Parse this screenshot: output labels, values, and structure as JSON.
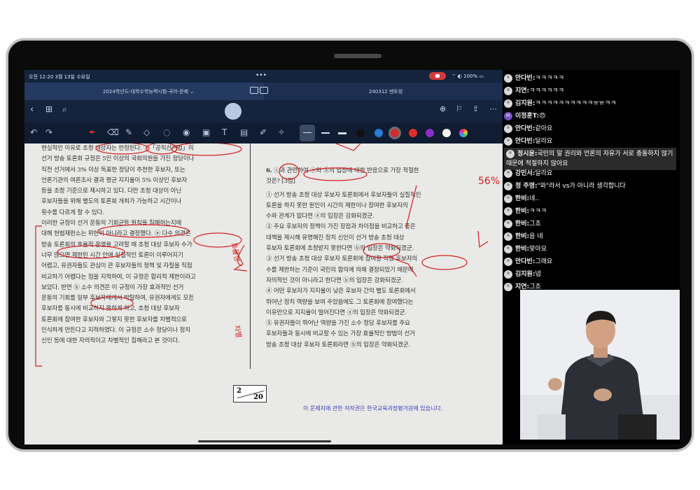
{
  "statusbar": {
    "time": "오전 12:20  3월 13일 수요일",
    "dots": "•••",
    "battery": "100%"
  },
  "tabs": [
    {
      "title": "2024학년도-대학수학능력시험-국어-문제 ⌄"
    },
    {
      "title": "240312 멘토링"
    }
  ],
  "left_column": [
    "현실적인 이유로 초청 대상자는 한정된다. ⓒ「공직선거법」의",
    "선거 방송 토론회 규정은 5인 이상의 국회의원을 가진 정당이나",
    "직전 선거에서 3% 이상 득표한 정당이 추천한 후보자, 또는",
    "언론기관의 여론조사 결과 평균 지지율이 5% 이상인 후보자",
    "등을 초청 기준으로 제시하고 있다. 다만 초청 대상이 아닌",
    "후보자들을 위해 별도의 토론회 개최가 가능하고 시간이나",
    "횟수를 다르게 할 수 있다.",
    "  이러한 규정이 선거 운동의 기회균등 원칙을 침해하는지에",
    "대해 헌법재판소는 위헌이 아니라고 결정했다. ⓐ 다수 의견은",
    "방송 토론회의 효율적 운영을 고려할 때 초청 대상 후보자 수가",
    "너무 많으면 제한된 시간 안에 실질적인 토론이 이루어지기",
    "어렵고, 유권자들도 관심이 큰 후보자들의 정책 및 자질을 직접",
    "비교하기 어렵다는 점을 지적하여, 이 규정은 합리적 제한이라고",
    "보았다. 반면 ⓑ 소수 의견은 이 규정이 가장 효과적인 선거",
    "운동의 기회를 일부 후보자에게서 박탈하여, 유권자에게도 모든",
    "후보자를 동시에 비교하지 못하게 하고, 초청 대상 후보자",
    "토론회에 참여한 후보자와 그렇지 못한 후보자를 차별적으로",
    "인식하게 만든다고 지적하였다. 이 규정은 소수 정당이나 정치",
    "신인 등에 대한 자의적이고 차별적인 침해라고 본 것이다."
  ],
  "question": {
    "number": "6.",
    "stem_1": " ⓒ과 관련하여 ⓐ와 ⓑ의 입장에 대한 반응으로 가장 적절한",
    "stem_2": "것은? [3점]",
    "options": [
      "① 선거 방송 초청 대상 후보자 토론회에서 후보자들이 실질적인",
      "   토론을 하지 못한 원인이 시간의 제한이나 참여한 후보자의",
      "   수와 관계가 없다면 ⓐ의 입장은 강화되겠군.",
      "② 주요 후보자의 정책이 가진 장점과 차이점을 비교하고 좋은",
      "   대책을 제시해 유명해진 정치 신인이 선거 방송 초청 대상",
      "   후보자 토론회에 초청받지 못한다면 ⓑ의 입장은 약화되겠군.",
      "③ 선거 방송 초청 대상 후보자 토론회에 참여할 적정 후보자의",
      "   수를 제한하는 기준이 국민의 합의에 의해 결정되었기 때문에",
      "   자의적인 것이 아니라고 한다면 ⓑ의 입장은 강화되겠군.",
      "④ 어떤 후보자가 지지율이 낮은 후보자 간의 별도 토론회에서",
      "   뛰어난 정치 역량을 보여 주었음에도 그 토론회에 참여했다는",
      "   이유만으로 지지율이 떨어진다면 ⓐ의 입장은 약화되겠군.",
      "⑤ 유권자들이 뛰어난 역량을 가진 소수 정당 후보자를 주요",
      "   후보자들과 동시에 비교할 수 있는 가장 효율적인 방법이 선거",
      "   방송 초청 대상 후보자 토론회라면 ⓑ의 입장은 약화되겠군."
    ]
  },
  "page_number": {
    "current": "2",
    "total": "20"
  },
  "copyright": "이 문제지에 관한 저작권은 한국교육과정평가원에 있습니다.",
  "handwriting": {
    "score": "56%",
    "left_note": "효율성",
    "left_note2": "차별"
  },
  "chat": [
    {
      "name": "안다빈:",
      "text": "ㅋㅋㅋㅋㅋ"
    },
    {
      "name": "지연:",
      "text": "ㅋㅋㅋㅋㅋㅋ"
    },
    {
      "name": "김지원:",
      "text": "ㅋㅋㅋㅋㅋㅋㅋㅋㅋㅋㅠㅠㅋㅋ"
    },
    {
      "name": "이정훈T:",
      "text": "😠",
      "letter": "H"
    },
    {
      "name": "안다빈:",
      "text": "같아요"
    },
    {
      "name": "안다빈:",
      "text": "달라요"
    },
    {
      "name": "정시윤:",
      "text": "국민의 알 권리와 언론의 자유가 서로 충돌하지 않기 때문에 적절하지 않아요"
    },
    {
      "name": "강민서:",
      "text": "달라요"
    },
    {
      "name": "정 주영:",
      "text": "\"와\"라서 vs가 아니라 생각합니다"
    },
    {
      "name": "한비:",
      "text": "네.."
    },
    {
      "name": "한비:",
      "text": "ㅋㅋㅋ"
    },
    {
      "name": "한비:",
      "text": "그쵸"
    },
    {
      "name": "한비:",
      "text": "음 네"
    },
    {
      "name": "한비:",
      "text": "맞아요"
    },
    {
      "name": "안다빈:",
      "text": "그래요"
    },
    {
      "name": "김지원:",
      "text": "넵"
    },
    {
      "name": "지연:",
      "text": "그쵸"
    }
  ]
}
